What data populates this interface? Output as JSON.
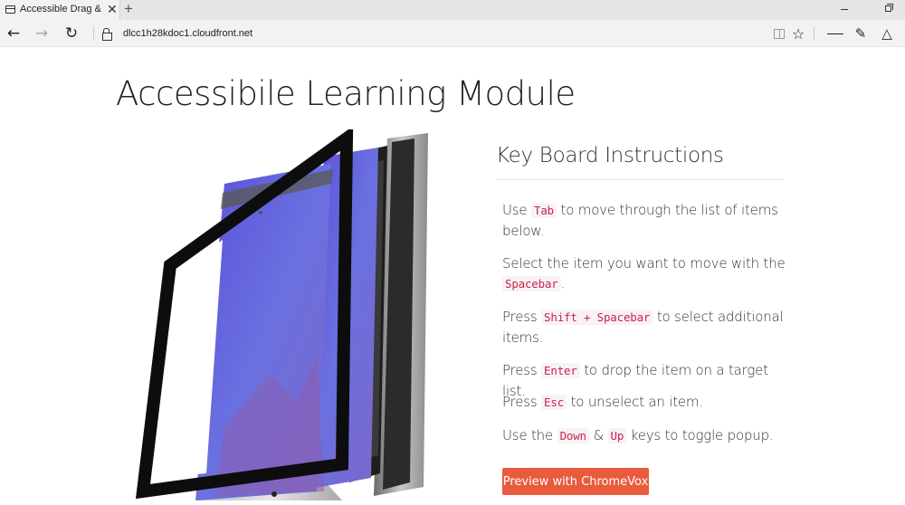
{
  "browser": {
    "tab_title": "Accessible Drag & Drop",
    "tab_close": "✕",
    "new_tab": "+",
    "url": "dlcc1h28kdoc1.cloudfront.net",
    "icons": [
      "back-icon",
      "forward-icon",
      "refresh-icon",
      "lock-icon",
      "reading-view-icon",
      "favorite-star-icon",
      "hub-icon",
      "web-note-icon",
      "share-icon",
      "minimize-icon",
      "restore-icon"
    ]
  },
  "page": {
    "title": "Accessibile Learning Module",
    "keyboard_heading": "Key Board Instructions",
    "instructions": [
      {
        "before": "Use ",
        "key1": "Tab",
        "mid": "",
        "key2": "",
        "after": " to move through the list of items below."
      },
      {
        "before": "Select the item you want to move with the ",
        "key1": "Spacebar",
        "mid": "",
        "key2": "",
        "after": "."
      },
      {
        "before": "Press ",
        "key1": "Shift + Spacebar",
        "mid": "",
        "key2": "",
        "after": " to select additional items."
      },
      {
        "before": "Press ",
        "key1": "Enter",
        "mid": "",
        "key2": "",
        "after": " to drop the item on a target list."
      },
      {
        "before": "Press ",
        "key1": "Esc",
        "mid": "",
        "key2": "",
        "after": " to unselect an item."
      },
      {
        "before": "Use the ",
        "key1": "Down",
        "mid": " & ",
        "key2": "Up",
        "after": " keys to toggle popup."
      }
    ],
    "preview_button": "Preview with ChromeVox",
    "accent_color": "#ea5a3d",
    "code_color": "#c7254e"
  }
}
